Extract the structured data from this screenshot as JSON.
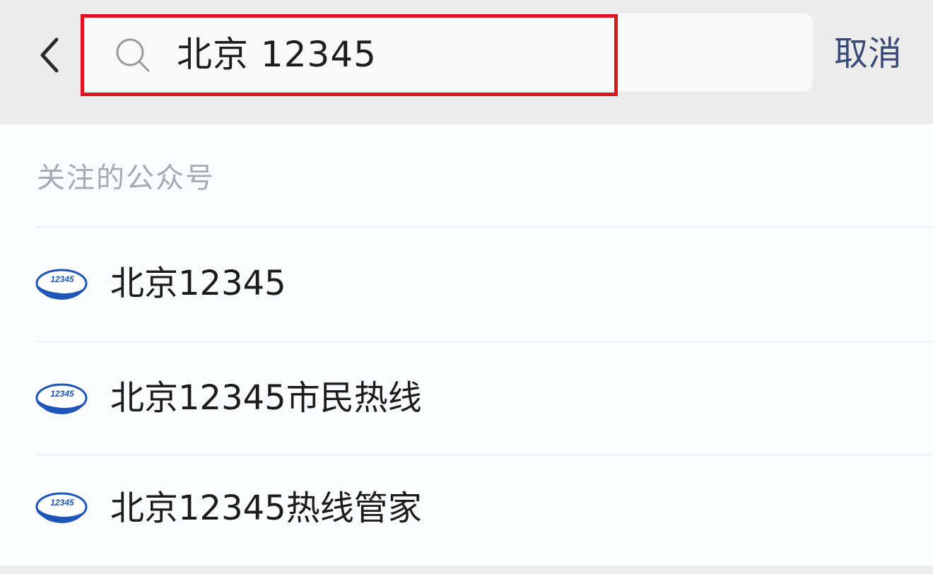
{
  "header": {
    "back_icon": "chevron-left-icon",
    "search": {
      "icon": "search-icon",
      "value": "北京 12345",
      "placeholder": ""
    },
    "cancel_label": "取消"
  },
  "section": {
    "title": "关注的公众号"
  },
  "results": [
    {
      "label": "北京12345",
      "avatar_text": "12345"
    },
    {
      "label": "北京12345市民热线",
      "avatar_text": "12345"
    },
    {
      "label": "北京12345热线管家",
      "avatar_text": "12345"
    }
  ],
  "colors": {
    "highlight": "#e0141e",
    "cancel": "#3a4a78",
    "avatar_blue": "#1d56b8",
    "section_text": "#a7a9b3"
  }
}
